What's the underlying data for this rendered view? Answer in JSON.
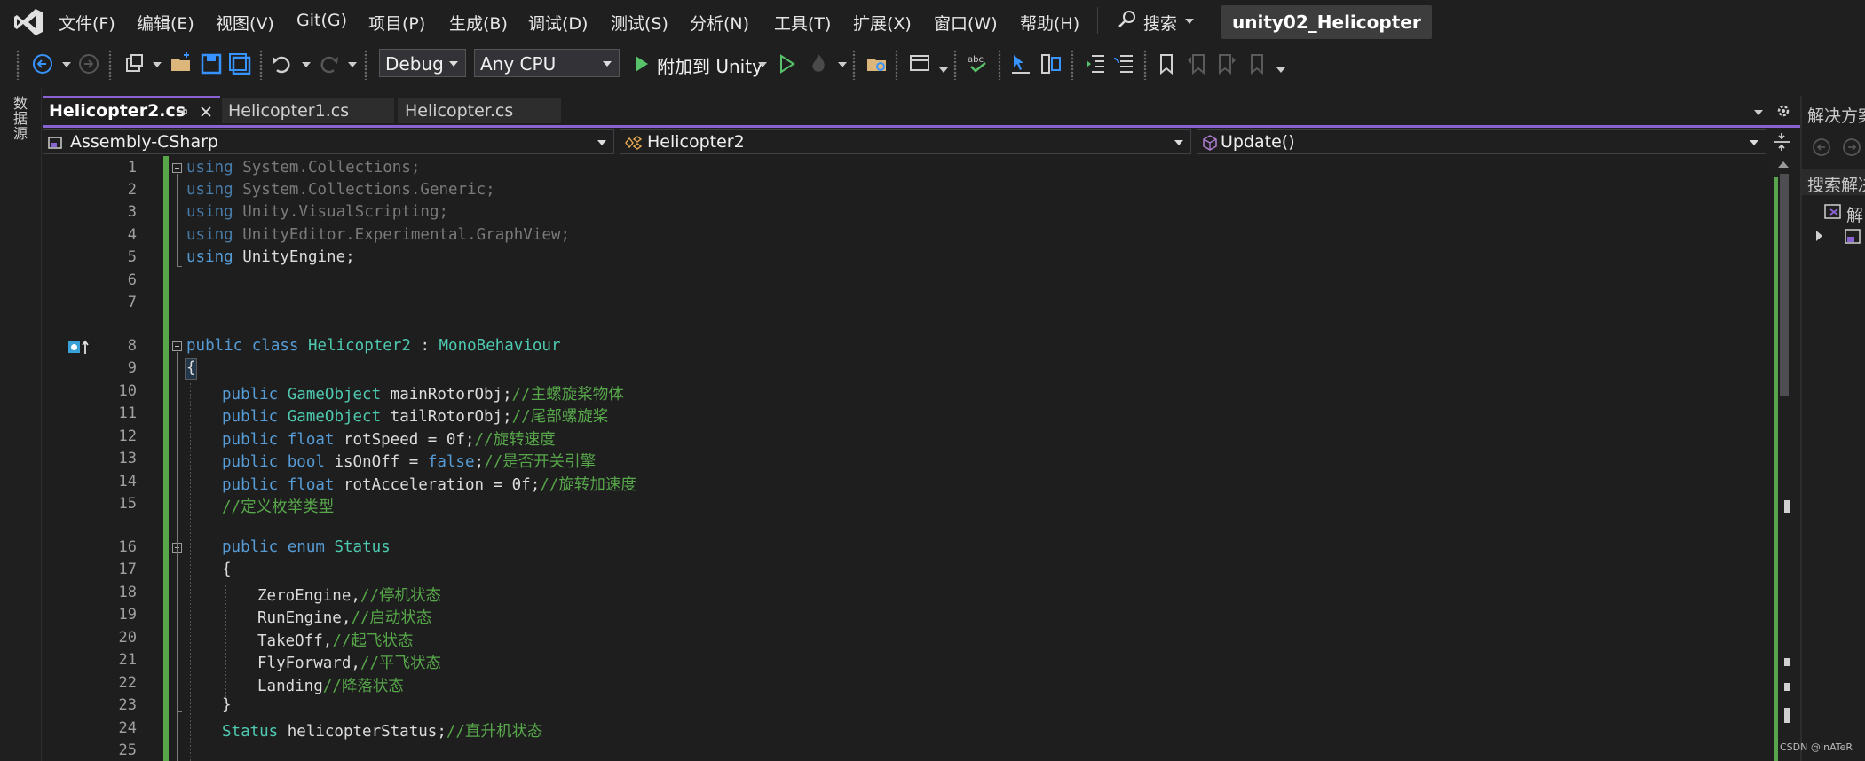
{
  "menu": [
    "文件(F)",
    "编辑(E)",
    "视图(V)",
    "Git(G)",
    "项目(P)",
    "生成(B)",
    "调试(D)",
    "测试(S)",
    "分析(N)",
    "工具(T)",
    "扩展(X)",
    "窗口(W)",
    "帮助(H)"
  ],
  "search_label": "搜索",
  "project_title": "unity02_Helicopter",
  "toolbar": {
    "config": "Debug",
    "platform": "Any CPU",
    "attach_label": "附加到 Unity"
  },
  "left_strip_label": "数据源",
  "tabs": [
    {
      "label": "Helicopter2.cs",
      "active": true
    },
    {
      "label": "Helicopter1.cs",
      "active": false
    },
    {
      "label": "Helicopter.cs",
      "active": false
    }
  ],
  "nav": {
    "project": "Assembly-CSharp",
    "class": "Helicopter2",
    "member": "Update()"
  },
  "right_panel": {
    "title": "解决方案",
    "search": "搜索解决",
    "item": "解"
  },
  "line_numbers": [
    "1",
    "2",
    "3",
    "4",
    "5",
    "6",
    "7",
    "8",
    "9",
    "10",
    "11",
    "12",
    "13",
    "14",
    "15",
    "16",
    "17",
    "18",
    "19",
    "20",
    "21",
    "22",
    "23",
    "24",
    "25"
  ],
  "code": {
    "l1": [
      "using",
      " System.Collections;"
    ],
    "l2": [
      "using",
      " System.Collections.Generic;"
    ],
    "l3": [
      "using",
      " Unity.VisualScripting;"
    ],
    "l4": [
      "using",
      " UnityEditor.Experimental.GraphView;"
    ],
    "l5": [
      "using",
      " UnityEngine;"
    ],
    "l8": [
      "public",
      " ",
      "class",
      " ",
      "Helicopter2",
      " : ",
      "MonoBehaviour"
    ],
    "l9": "{",
    "l10": [
      "public",
      " ",
      "GameObject",
      " mainRotorObj;",
      "//主螺旋桨物体"
    ],
    "l11": [
      "public",
      " ",
      "GameObject",
      " tailRotorObj;",
      "//尾部螺旋桨"
    ],
    "l12": [
      "public",
      " ",
      "float",
      " rotSpeed = 0f;",
      "//旋转速度"
    ],
    "l13": [
      "public",
      " ",
      "bool",
      " isOnOff = ",
      "false",
      ";",
      "//是否开关引擎"
    ],
    "l14": [
      "public",
      " ",
      "float",
      " rotAcceleration = 0f;",
      "//旋转加速度"
    ],
    "l15": "//定义枚举类型",
    "l16": [
      "public",
      " ",
      "enum",
      " ",
      "Status"
    ],
    "l17": "{",
    "l18": [
      "ZeroEngine,",
      "//停机状态"
    ],
    "l19": [
      "RunEngine,",
      "//启动状态"
    ],
    "l20": [
      "TakeOff,",
      "//起飞状态"
    ],
    "l21": [
      "FlyForward,",
      "//平飞状态"
    ],
    "l22": [
      "Landing",
      "//降落状态"
    ],
    "l23": "}",
    "l24": [
      "Status",
      " helicopterStatus;",
      "//直升机状态"
    ]
  },
  "watermark": "CSDN @InATeR",
  "colors": {
    "keyword": "#569cd6",
    "type": "#4ec9b0",
    "comment": "#57a64a",
    "accent": "#8a63d2"
  }
}
